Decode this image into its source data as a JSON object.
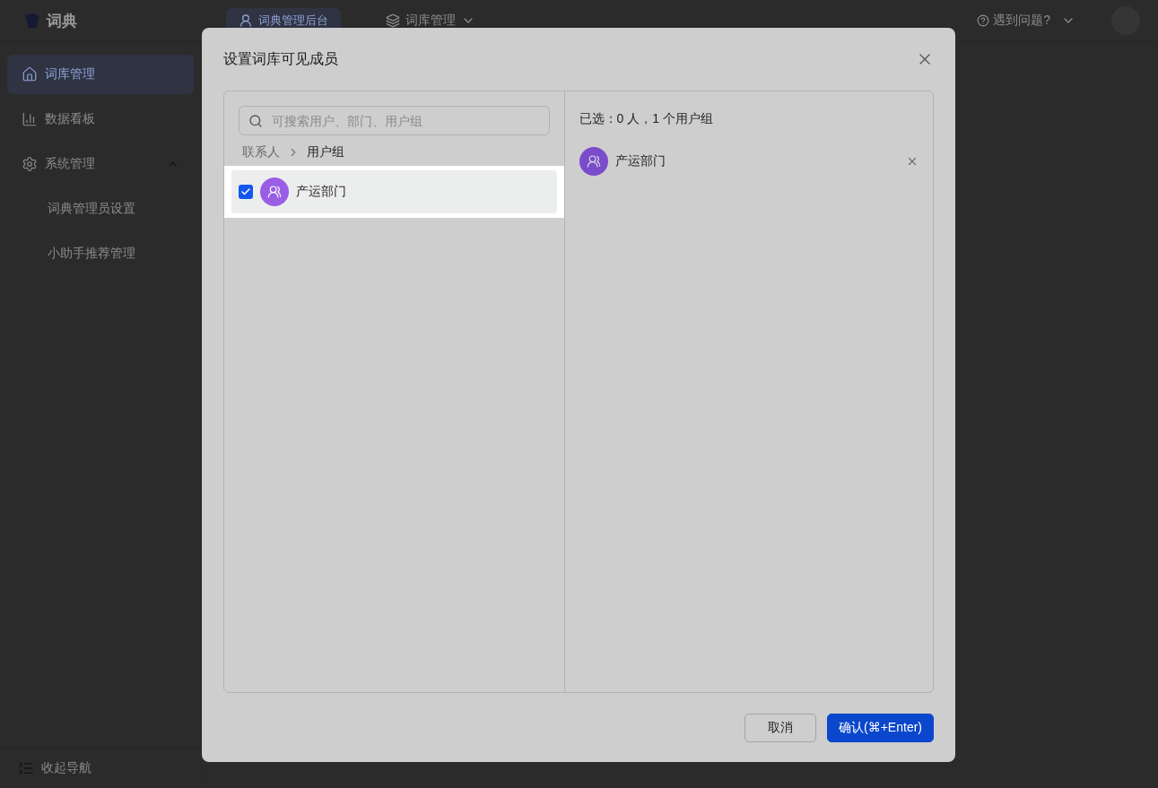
{
  "app": {
    "logo": "词典",
    "top_tabs": [
      {
        "label": "词典管理后台",
        "selected": true
      }
    ],
    "menu": {
      "label": "词库管理"
    },
    "help": "遇到问题?"
  },
  "sidebar": {
    "items": [
      {
        "label": "词库管理",
        "selected": true
      },
      {
        "label": "数据看板",
        "selected": false
      },
      {
        "label": "系统管理",
        "selected": false,
        "expanded": true,
        "children": [
          {
            "label": "词典管理员设置",
            "selected": false
          },
          {
            "label": "小助手推荐管理",
            "selected": false
          }
        ]
      }
    ],
    "collapse": "收起导航"
  },
  "dialog": {
    "title": "设置词库可见成员",
    "search": {
      "placeholder": "可搜索用户、部门、用户组"
    },
    "breadcrumb": [
      "联系人",
      "用户组"
    ],
    "items": [
      {
        "name": "产运部门",
        "checked": true
      }
    ],
    "summary": "已选：0 人，1 个用户组",
    "selected": [
      {
        "name": "产运部门"
      }
    ],
    "buttons": [
      {
        "label": "取消",
        "kind": "secondary"
      },
      {
        "label": "确认(⌘+Enter)",
        "kind": "primary"
      }
    ]
  }
}
